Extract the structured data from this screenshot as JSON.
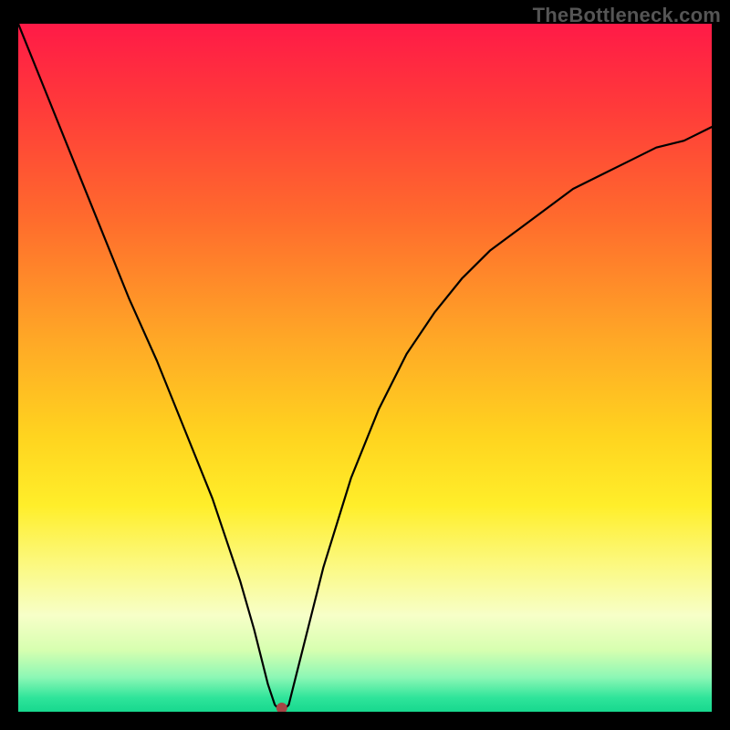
{
  "watermark": "TheBottleneck.com",
  "chart_data": {
    "type": "line",
    "title": "",
    "xlabel": "",
    "ylabel": "",
    "xlim": [
      0,
      100
    ],
    "ylim": [
      0,
      100
    ],
    "grid": false,
    "legend": false,
    "gradient_background": {
      "direction": "vertical",
      "top_color": "#ff1a47",
      "bottom_color": "#17d88e",
      "meaning": "red high = worse, green low = better"
    },
    "optimal_point": {
      "x": 38,
      "y": 0
    },
    "series": [
      {
        "name": "bottleneck-curve",
        "x": [
          0,
          4,
          8,
          12,
          16,
          20,
          24,
          28,
          32,
          34,
          36,
          37,
          38,
          39,
          40,
          42,
          44,
          48,
          52,
          56,
          60,
          64,
          68,
          72,
          76,
          80,
          84,
          88,
          92,
          96,
          100
        ],
        "y": [
          100,
          90,
          80,
          70,
          60,
          51,
          41,
          31,
          19,
          12,
          4,
          1,
          0,
          1,
          5,
          13,
          21,
          34,
          44,
          52,
          58,
          63,
          67,
          70,
          73,
          76,
          78,
          80,
          82,
          83,
          85
        ]
      }
    ]
  }
}
